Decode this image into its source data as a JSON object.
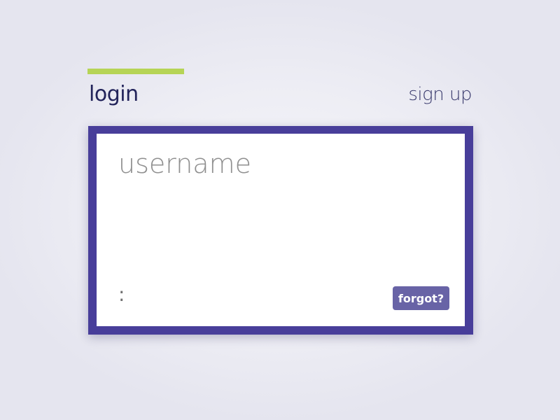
{
  "tabs": {
    "login_label": "login",
    "signup_label": "sign up",
    "active": "login"
  },
  "form": {
    "username_placeholder": "username",
    "username_value": "",
    "separator_text": ":",
    "forgot_label": "forgot?"
  },
  "colors": {
    "accent": "#b6d456",
    "card_border": "#483e9a",
    "button": "#6863a6",
    "tab_text": "#22235a"
  }
}
